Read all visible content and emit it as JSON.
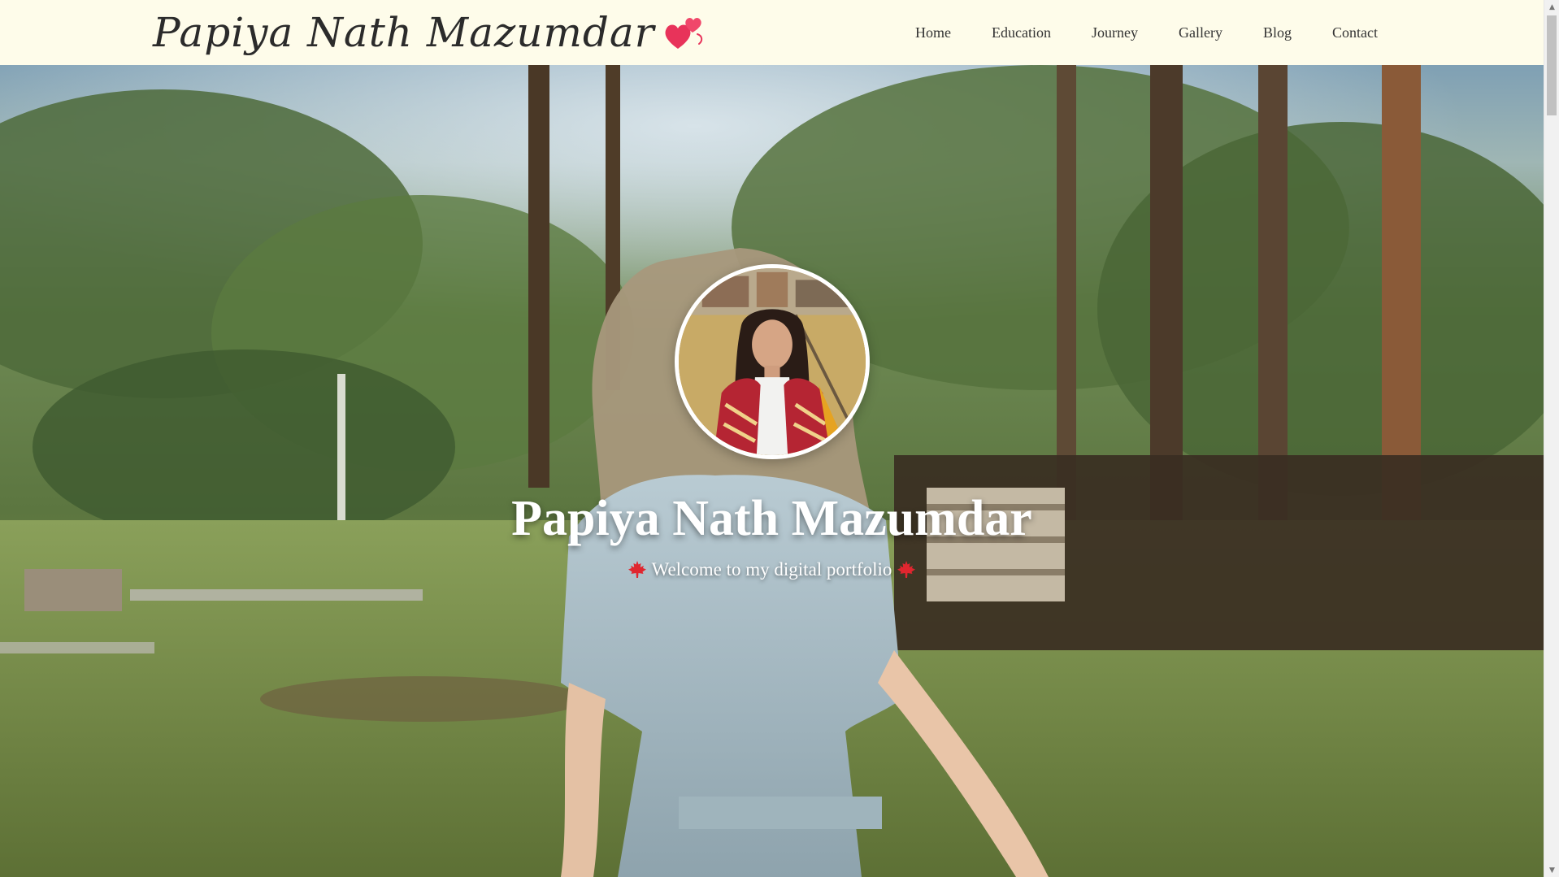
{
  "header": {
    "brand": "Papiya Nath Mazumdar",
    "brand_icon": "double-heart-icon",
    "nav": [
      {
        "label": "Home"
      },
      {
        "label": "Education"
      },
      {
        "label": "Journey"
      },
      {
        "label": "Gallery"
      },
      {
        "label": "Blog"
      },
      {
        "label": "Contact"
      }
    ]
  },
  "hero": {
    "title": "Papiya Nath Mazumdar",
    "subtitle": "Welcome to my digital portfolio",
    "subtitle_icon": "maple-leaf-icon",
    "avatar": "profile-photo"
  },
  "colors": {
    "header_bg": "#fefcea",
    "heart": "#e8335a",
    "leaf": "#e0262f",
    "text_light": "#ffffff"
  }
}
